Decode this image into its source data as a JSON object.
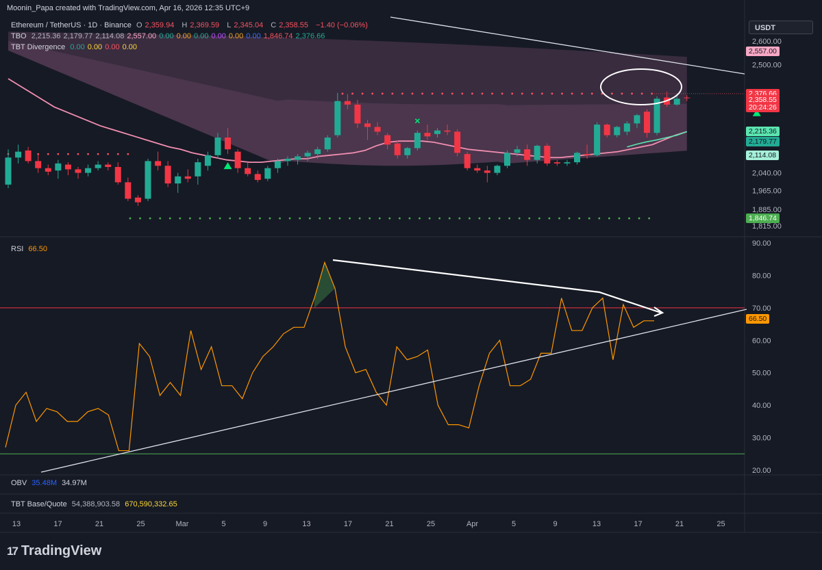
{
  "header": {
    "credit": "Moonin_Papa created with TradingView.com, Apr 16, 2026 12:35 UTC+9"
  },
  "legend": {
    "symbol": "Ethereum / TetherUS · 1D · Binance",
    "ohlc": {
      "o_label": "O",
      "o": "2,359.94",
      "h_label": "H",
      "h": "2,369.59",
      "l_label": "L",
      "l": "2,345.04",
      "c_label": "C",
      "c": "2,358.55",
      "change": "−1.40 (−0.06%)"
    },
    "tbo": {
      "name": "TBO",
      "values": [
        "2,215.36",
        "2,179.77",
        "2,114.08",
        "2,557.00",
        "0.00",
        "0.00",
        "0.00",
        "0.00",
        "0.00",
        "0.00",
        "1,846.74",
        "2,376.66"
      ],
      "colors": [
        "#b2b5be",
        "#b2b5be",
        "#b2b5be",
        "#f7a8c4",
        "#22ab94",
        "#f6a623",
        "#22ab94",
        "#c050ff",
        "#f6a623",
        "#3a6fff",
        "#f7525f",
        "#22ab94"
      ]
    },
    "divergence": {
      "name": "TBT Divergence",
      "values": [
        "0.00",
        "0.00",
        "0.00",
        "0.00"
      ],
      "colors": [
        "#22ab94",
        "#fdd835",
        "#f7525f",
        "#fdd835"
      ]
    }
  },
  "currency_button": "USDT",
  "price_tags": [
    {
      "text": "2,557.00",
      "bg": "#f7a8c4",
      "fg": "#131722"
    },
    {
      "text": "2,376.66",
      "bg": "#f23645",
      "fg": "#ffffff"
    },
    {
      "text": "2,358.55",
      "bg": "#f23645",
      "fg": "#ffffff"
    },
    {
      "text": "20:24:26",
      "bg": "#f23645",
      "fg": "#ffffff"
    },
    {
      "text": "2,215.36",
      "bg": "#5be5b0",
      "fg": "#131722"
    },
    {
      "text": "2,179.77",
      "bg": "#22ab94",
      "fg": "#131722"
    },
    {
      "text": "2,114.08",
      "bg": "#a5f0d8",
      "fg": "#131722"
    },
    {
      "text": "1,846.74",
      "bg": "#4caf50",
      "fg": "#ffffff"
    },
    {
      "text": "66.50",
      "bg": "#ff9800",
      "fg": "#131722"
    }
  ],
  "rsi_legend": {
    "name": "RSI",
    "value": "66.50"
  },
  "obv_legend": {
    "name": "OBV",
    "value1": "35.48M",
    "value2": "34.97M"
  },
  "base_quote_legend": {
    "name": "TBT Base/Quote",
    "value1": "54,388,903.58",
    "value2": "670,590,332.65"
  },
  "brand": {
    "logo": "17",
    "name": "TradingView"
  },
  "chart_data": [
    {
      "type": "candlestick",
      "title": "Ethereum / TetherUS · 1D · Binance",
      "y_ticks": [
        "2,600.00",
        "2,500.00",
        "2,040.00",
        "1,965.00",
        "1,885.00",
        "1,815.00"
      ],
      "ylim": [
        1800,
        2630
      ],
      "x_ticks": [
        "13",
        "17",
        "21",
        "25",
        "Mar",
        "5",
        "9",
        "13",
        "17",
        "21",
        "25",
        "Apr",
        "5",
        "9",
        "13",
        "17",
        "21",
        "25"
      ],
      "candles": [
        {
          "o": 1990,
          "h": 2140,
          "l": 1975,
          "c": 2105
        },
        {
          "o": 2105,
          "h": 2160,
          "l": 2080,
          "c": 2130
        },
        {
          "o": 2135,
          "h": 2150,
          "l": 2080,
          "c": 2090
        },
        {
          "o": 2090,
          "h": 2120,
          "l": 2040,
          "c": 2060
        },
        {
          "o": 2060,
          "h": 2075,
          "l": 2030,
          "c": 2045
        },
        {
          "o": 2050,
          "h": 2095,
          "l": 2015,
          "c": 2080
        },
        {
          "o": 2075,
          "h": 2085,
          "l": 2030,
          "c": 2055
        },
        {
          "o": 2055,
          "h": 2065,
          "l": 2015,
          "c": 2040
        },
        {
          "o": 2040,
          "h": 2075,
          "l": 2025,
          "c": 2060
        },
        {
          "o": 2060,
          "h": 2090,
          "l": 2050,
          "c": 2075
        },
        {
          "o": 2075,
          "h": 2085,
          "l": 2050,
          "c": 2065
        },
        {
          "o": 2065,
          "h": 2085,
          "l": 1990,
          "c": 2000
        },
        {
          "o": 2000,
          "h": 2020,
          "l": 1920,
          "c": 1930
        },
        {
          "o": 1935,
          "h": 1945,
          "l": 1900,
          "c": 1915
        },
        {
          "o": 1930,
          "h": 2100,
          "l": 1920,
          "c": 2090
        },
        {
          "o": 2090,
          "h": 2130,
          "l": 2050,
          "c": 2070
        },
        {
          "o": 2070,
          "h": 2090,
          "l": 1980,
          "c": 1995
        },
        {
          "o": 1995,
          "h": 2040,
          "l": 1955,
          "c": 2025
        },
        {
          "o": 2025,
          "h": 2055,
          "l": 2000,
          "c": 2015
        },
        {
          "o": 2025,
          "h": 2100,
          "l": 1990,
          "c": 2085
        },
        {
          "o": 2070,
          "h": 2130,
          "l": 2050,
          "c": 2115
        },
        {
          "o": 2115,
          "h": 2210,
          "l": 2100,
          "c": 2190
        },
        {
          "o": 2190,
          "h": 2230,
          "l": 2120,
          "c": 2140
        },
        {
          "o": 2130,
          "h": 2140,
          "l": 2040,
          "c": 2060
        },
        {
          "o": 2060,
          "h": 2085,
          "l": 2025,
          "c": 2035
        },
        {
          "o": 2035,
          "h": 2050,
          "l": 2000,
          "c": 2010
        },
        {
          "o": 2015,
          "h": 2070,
          "l": 2005,
          "c": 2060
        },
        {
          "o": 2060,
          "h": 2100,
          "l": 2040,
          "c": 2090
        },
        {
          "o": 2090,
          "h": 2110,
          "l": 2070,
          "c": 2100
        },
        {
          "o": 2095,
          "h": 2120,
          "l": 2075,
          "c": 2110
        },
        {
          "o": 2110,
          "h": 2135,
          "l": 2090,
          "c": 2125
        },
        {
          "o": 2120,
          "h": 2150,
          "l": 2100,
          "c": 2140
        },
        {
          "o": 2140,
          "h": 2200,
          "l": 2130,
          "c": 2190
        },
        {
          "o": 2200,
          "h": 2380,
          "l": 2190,
          "c": 2345
        },
        {
          "o": 2345,
          "h": 2375,
          "l": 2310,
          "c": 2330
        },
        {
          "o": 2330,
          "h": 2350,
          "l": 2230,
          "c": 2250
        },
        {
          "o": 2250,
          "h": 2265,
          "l": 2180,
          "c": 2235
        },
        {
          "o": 2235,
          "h": 2255,
          "l": 2200,
          "c": 2215
        },
        {
          "o": 2200,
          "h": 2210,
          "l": 2140,
          "c": 2160
        },
        {
          "o": 2165,
          "h": 2180,
          "l": 2100,
          "c": 2115
        },
        {
          "o": 2115,
          "h": 2150,
          "l": 2100,
          "c": 2145
        },
        {
          "o": 2145,
          "h": 2220,
          "l": 2135,
          "c": 2210
        },
        {
          "o": 2210,
          "h": 2245,
          "l": 2180,
          "c": 2195
        },
        {
          "o": 2205,
          "h": 2230,
          "l": 2190,
          "c": 2220
        },
        {
          "o": 2220,
          "h": 2245,
          "l": 2200,
          "c": 2215
        },
        {
          "o": 2215,
          "h": 2225,
          "l": 2110,
          "c": 2125
        },
        {
          "o": 2120,
          "h": 2130,
          "l": 2050,
          "c": 2060
        },
        {
          "o": 2060,
          "h": 2075,
          "l": 2040,
          "c": 2050
        },
        {
          "o": 2050,
          "h": 2070,
          "l": 2000,
          "c": 2040
        },
        {
          "o": 2040,
          "h": 2075,
          "l": 2030,
          "c": 2070
        },
        {
          "o": 2070,
          "h": 2135,
          "l": 2060,
          "c": 2125
        },
        {
          "o": 2125,
          "h": 2155,
          "l": 2110,
          "c": 2140
        },
        {
          "o": 2140,
          "h": 2160,
          "l": 2070,
          "c": 2095
        },
        {
          "o": 2095,
          "h": 2160,
          "l": 2080,
          "c": 2155
        },
        {
          "o": 2155,
          "h": 2165,
          "l": 2070,
          "c": 2080
        },
        {
          "o": 2085,
          "h": 2095,
          "l": 2070,
          "c": 2080
        },
        {
          "o": 2080,
          "h": 2095,
          "l": 2070,
          "c": 2085
        },
        {
          "o": 2085,
          "h": 2130,
          "l": 2075,
          "c": 2125
        },
        {
          "o": 2120,
          "h": 2160,
          "l": 2100,
          "c": 2115
        },
        {
          "o": 2115,
          "h": 2255,
          "l": 2110,
          "c": 2245
        },
        {
          "o": 2245,
          "h": 2250,
          "l": 2190,
          "c": 2200
        },
        {
          "o": 2200,
          "h": 2240,
          "l": 2190,
          "c": 2235
        },
        {
          "o": 2215,
          "h": 2260,
          "l": 2200,
          "c": 2250
        },
        {
          "o": 2250,
          "h": 2290,
          "l": 2230,
          "c": 2285
        },
        {
          "o": 2300,
          "h": 2310,
          "l": 2190,
          "c": 2210
        },
        {
          "o": 2210,
          "h": 2365,
          "l": 2200,
          "c": 2355
        },
        {
          "o": 2360,
          "h": 2385,
          "l": 2320,
          "c": 2330
        },
        {
          "o": 2330,
          "h": 2375,
          "l": 2325,
          "c": 2355
        },
        {
          "o": 2360,
          "h": 2370,
          "l": 2345,
          "c": 2358
        }
      ],
      "resistance_level": 2376.66,
      "support_level": 1846.74,
      "buy_signals": [
        {
          "index": 22,
          "shape": "triangle"
        },
        {
          "index": 41,
          "shape": "cross"
        },
        {
          "index": 75,
          "shape": "triangle"
        }
      ]
    },
    {
      "type": "line",
      "title": "RSI",
      "y_ticks": [
        "90.00",
        "80.00",
        "70.00",
        "60.00",
        "50.00",
        "40.00",
        "30.00",
        "20.00"
      ],
      "ylim": [
        20,
        90
      ],
      "overbought": 70,
      "oversold": 25,
      "last_value": 66.5,
      "values": [
        27,
        40,
        44,
        35,
        39,
        38,
        35,
        35,
        38,
        39,
        37,
        26,
        26,
        59,
        55,
        43,
        47,
        43,
        63,
        51,
        58,
        46,
        46,
        42,
        50,
        55,
        58,
        62,
        64,
        64,
        73,
        84,
        76,
        58,
        50,
        51,
        44,
        40,
        58,
        54,
        55,
        57,
        40,
        34,
        34,
        33,
        46,
        56,
        60,
        46,
        46,
        48,
        56,
        56,
        73,
        63,
        63,
        70,
        73,
        54,
        71,
        64,
        66,
        66
      ]
    }
  ]
}
